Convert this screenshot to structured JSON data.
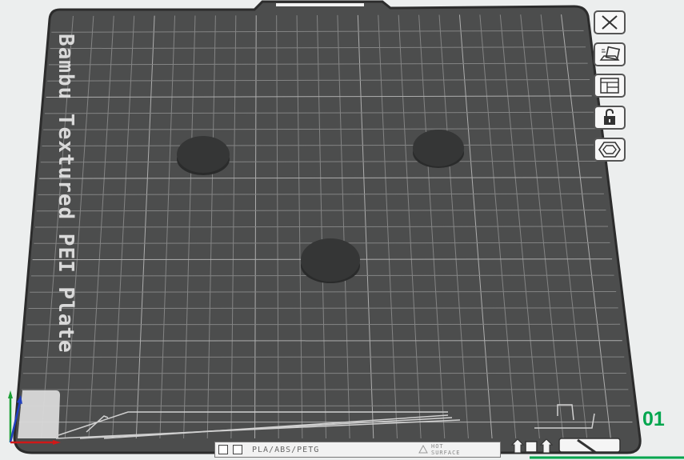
{
  "plate": {
    "label": "Bambu Textured PEI Plate",
    "number": "01",
    "bottom_bar": {
      "materials": "PLA/ABS/PETG",
      "hot_surface": "HOT\nSURFACE"
    }
  },
  "toolbar": {
    "buttons": [
      {
        "name": "close-plate-button",
        "icon": "close-icon"
      },
      {
        "name": "auto-orient-button",
        "icon": "orient-icon"
      },
      {
        "name": "arrange-button",
        "icon": "arrange-icon"
      },
      {
        "name": "lock-plate-button",
        "icon": "lock-icon"
      },
      {
        "name": "plate-settings-button",
        "icon": "hex-settings-icon"
      }
    ]
  },
  "objects": [
    {
      "name": "disc-object-1"
    },
    {
      "name": "disc-object-2"
    },
    {
      "name": "disc-object-3"
    }
  ],
  "colors": {
    "plate": "#4c4d4d",
    "grid": "#8a8a8a",
    "disc": "#353636",
    "accent": "#00a64e",
    "background": "#eceeee"
  }
}
